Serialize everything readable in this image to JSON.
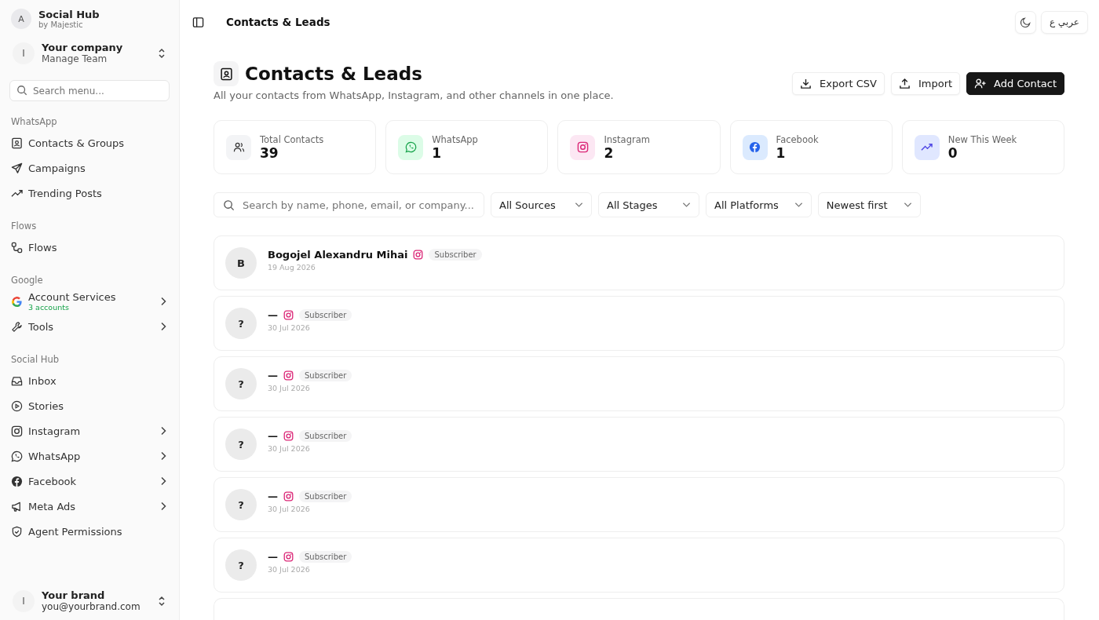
{
  "brand": {
    "avatar": "A",
    "name": "Social Hub",
    "by": "by Majestic"
  },
  "team": {
    "avatar": "I",
    "name": "Your company",
    "sub": "Manage Team"
  },
  "sidebar_search": {
    "placeholder": "Search menu..."
  },
  "sections": [
    {
      "title": "WhatsApp",
      "items": [
        {
          "label": "Contacts & Groups",
          "expandable": false
        },
        {
          "label": "Campaigns",
          "expandable": false
        },
        {
          "label": "Trending Posts",
          "expandable": false
        }
      ]
    },
    {
      "title": "Flows",
      "items": [
        {
          "label": "Flows",
          "expandable": false
        }
      ]
    },
    {
      "title": "Google",
      "items": [
        {
          "label": "Account Services",
          "sub": "3 accounts",
          "expandable": true
        },
        {
          "label": "Tools",
          "expandable": true
        }
      ]
    },
    {
      "title": "Social Hub",
      "items": [
        {
          "label": "Inbox",
          "expandable": false
        },
        {
          "label": "Stories",
          "expandable": false
        },
        {
          "label": "Instagram",
          "expandable": true
        },
        {
          "label": "WhatsApp",
          "expandable": true
        },
        {
          "label": "Facebook",
          "expandable": true
        },
        {
          "label": "Meta Ads",
          "expandable": true
        },
        {
          "label": "Agent Permissions",
          "expandable": false
        }
      ]
    }
  ],
  "user": {
    "avatar": "I",
    "name": "Your brand",
    "email": "you@yourbrand.com"
  },
  "topbar": {
    "title": "Contacts & Leads",
    "language": "عربي ع"
  },
  "page": {
    "title": "Contacts & Leads",
    "subtitle": "All your contacts from WhatsApp, Instagram, and other channels in one place.",
    "buttons": [
      {
        "label": "Export CSV",
        "primary": false
      },
      {
        "label": "Import",
        "primary": false
      },
      {
        "label": "Add Contact",
        "primary": true
      }
    ]
  },
  "stats": [
    {
      "label": "Total Contacts",
      "value": "39",
      "color": "#f3f4f6"
    },
    {
      "label": "WhatsApp",
      "value": "1",
      "color": "#dcfce7"
    },
    {
      "label": "Instagram",
      "value": "2",
      "color": "#fce7f3"
    },
    {
      "label": "Facebook",
      "value": "1",
      "color": "#dbeafe"
    },
    {
      "label": "New This Week",
      "value": "0",
      "color": "#e0e7ff"
    }
  ],
  "search": {
    "placeholder": "Search by name, phone, email, or company..."
  },
  "filters": [
    "All Sources",
    "All Stages",
    "All Platforms",
    "Newest first"
  ],
  "contacts": [
    {
      "avatar": "B",
      "name": "Bogojel Alexandru Mihai",
      "tag": "Subscriber",
      "date": "19 Aug 2026"
    },
    {
      "avatar": "?",
      "name": "—",
      "tag": "Subscriber",
      "date": "30 Jul 2026"
    },
    {
      "avatar": "?",
      "name": "—",
      "tag": "Subscriber",
      "date": "30 Jul 2026"
    },
    {
      "avatar": "?",
      "name": "—",
      "tag": "Subscriber",
      "date": "30 Jul 2026"
    },
    {
      "avatar": "?",
      "name": "—",
      "tag": "Subscriber",
      "date": "30 Jul 2026"
    },
    {
      "avatar": "?",
      "name": "—",
      "tag": "Subscriber",
      "date": "30 Jul 2026"
    }
  ]
}
